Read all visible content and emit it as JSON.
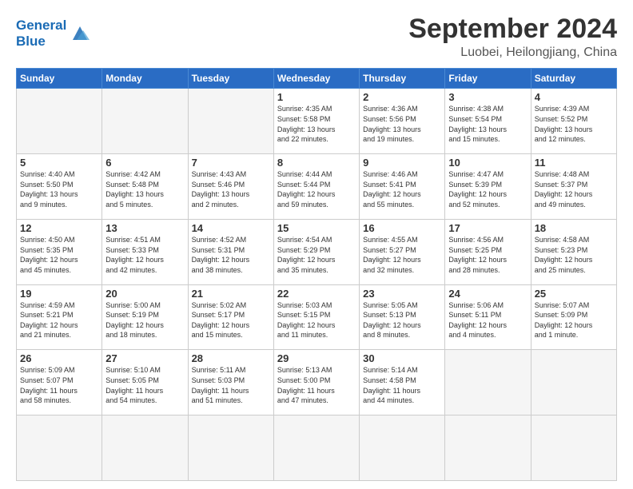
{
  "header": {
    "logo_general": "General",
    "logo_blue": "Blue",
    "month": "September 2024",
    "location": "Luobei, Heilongjiang, China"
  },
  "weekdays": [
    "Sunday",
    "Monday",
    "Tuesday",
    "Wednesday",
    "Thursday",
    "Friday",
    "Saturday"
  ],
  "days": [
    {
      "day": "",
      "info": ""
    },
    {
      "day": "",
      "info": ""
    },
    {
      "day": "",
      "info": ""
    },
    {
      "day": "1",
      "info": "Sunrise: 4:35 AM\nSunset: 5:58 PM\nDaylight: 13 hours\nand 22 minutes."
    },
    {
      "day": "2",
      "info": "Sunrise: 4:36 AM\nSunset: 5:56 PM\nDaylight: 13 hours\nand 19 minutes."
    },
    {
      "day": "3",
      "info": "Sunrise: 4:38 AM\nSunset: 5:54 PM\nDaylight: 13 hours\nand 15 minutes."
    },
    {
      "day": "4",
      "info": "Sunrise: 4:39 AM\nSunset: 5:52 PM\nDaylight: 13 hours\nand 12 minutes."
    },
    {
      "day": "5",
      "info": "Sunrise: 4:40 AM\nSunset: 5:50 PM\nDaylight: 13 hours\nand 9 minutes."
    },
    {
      "day": "6",
      "info": "Sunrise: 4:42 AM\nSunset: 5:48 PM\nDaylight: 13 hours\nand 5 minutes."
    },
    {
      "day": "7",
      "info": "Sunrise: 4:43 AM\nSunset: 5:46 PM\nDaylight: 13 hours\nand 2 minutes."
    },
    {
      "day": "8",
      "info": "Sunrise: 4:44 AM\nSunset: 5:44 PM\nDaylight: 12 hours\nand 59 minutes."
    },
    {
      "day": "9",
      "info": "Sunrise: 4:46 AM\nSunset: 5:41 PM\nDaylight: 12 hours\nand 55 minutes."
    },
    {
      "day": "10",
      "info": "Sunrise: 4:47 AM\nSunset: 5:39 PM\nDaylight: 12 hours\nand 52 minutes."
    },
    {
      "day": "11",
      "info": "Sunrise: 4:48 AM\nSunset: 5:37 PM\nDaylight: 12 hours\nand 49 minutes."
    },
    {
      "day": "12",
      "info": "Sunrise: 4:50 AM\nSunset: 5:35 PM\nDaylight: 12 hours\nand 45 minutes."
    },
    {
      "day": "13",
      "info": "Sunrise: 4:51 AM\nSunset: 5:33 PM\nDaylight: 12 hours\nand 42 minutes."
    },
    {
      "day": "14",
      "info": "Sunrise: 4:52 AM\nSunset: 5:31 PM\nDaylight: 12 hours\nand 38 minutes."
    },
    {
      "day": "15",
      "info": "Sunrise: 4:54 AM\nSunset: 5:29 PM\nDaylight: 12 hours\nand 35 minutes."
    },
    {
      "day": "16",
      "info": "Sunrise: 4:55 AM\nSunset: 5:27 PM\nDaylight: 12 hours\nand 32 minutes."
    },
    {
      "day": "17",
      "info": "Sunrise: 4:56 AM\nSunset: 5:25 PM\nDaylight: 12 hours\nand 28 minutes."
    },
    {
      "day": "18",
      "info": "Sunrise: 4:58 AM\nSunset: 5:23 PM\nDaylight: 12 hours\nand 25 minutes."
    },
    {
      "day": "19",
      "info": "Sunrise: 4:59 AM\nSunset: 5:21 PM\nDaylight: 12 hours\nand 21 minutes."
    },
    {
      "day": "20",
      "info": "Sunrise: 5:00 AM\nSunset: 5:19 PM\nDaylight: 12 hours\nand 18 minutes."
    },
    {
      "day": "21",
      "info": "Sunrise: 5:02 AM\nSunset: 5:17 PM\nDaylight: 12 hours\nand 15 minutes."
    },
    {
      "day": "22",
      "info": "Sunrise: 5:03 AM\nSunset: 5:15 PM\nDaylight: 12 hours\nand 11 minutes."
    },
    {
      "day": "23",
      "info": "Sunrise: 5:05 AM\nSunset: 5:13 PM\nDaylight: 12 hours\nand 8 minutes."
    },
    {
      "day": "24",
      "info": "Sunrise: 5:06 AM\nSunset: 5:11 PM\nDaylight: 12 hours\nand 4 minutes."
    },
    {
      "day": "25",
      "info": "Sunrise: 5:07 AM\nSunset: 5:09 PM\nDaylight: 12 hours\nand 1 minute."
    },
    {
      "day": "26",
      "info": "Sunrise: 5:09 AM\nSunset: 5:07 PM\nDaylight: 11 hours\nand 58 minutes."
    },
    {
      "day": "27",
      "info": "Sunrise: 5:10 AM\nSunset: 5:05 PM\nDaylight: 11 hours\nand 54 minutes."
    },
    {
      "day": "28",
      "info": "Sunrise: 5:11 AM\nSunset: 5:03 PM\nDaylight: 11 hours\nand 51 minutes."
    },
    {
      "day": "29",
      "info": "Sunrise: 5:13 AM\nSunset: 5:00 PM\nDaylight: 11 hours\nand 47 minutes."
    },
    {
      "day": "30",
      "info": "Sunrise: 5:14 AM\nSunset: 4:58 PM\nDaylight: 11 hours\nand 44 minutes."
    },
    {
      "day": "",
      "info": ""
    },
    {
      "day": "",
      "info": ""
    },
    {
      "day": "",
      "info": ""
    },
    {
      "day": "",
      "info": ""
    },
    {
      "day": "",
      "info": ""
    }
  ]
}
